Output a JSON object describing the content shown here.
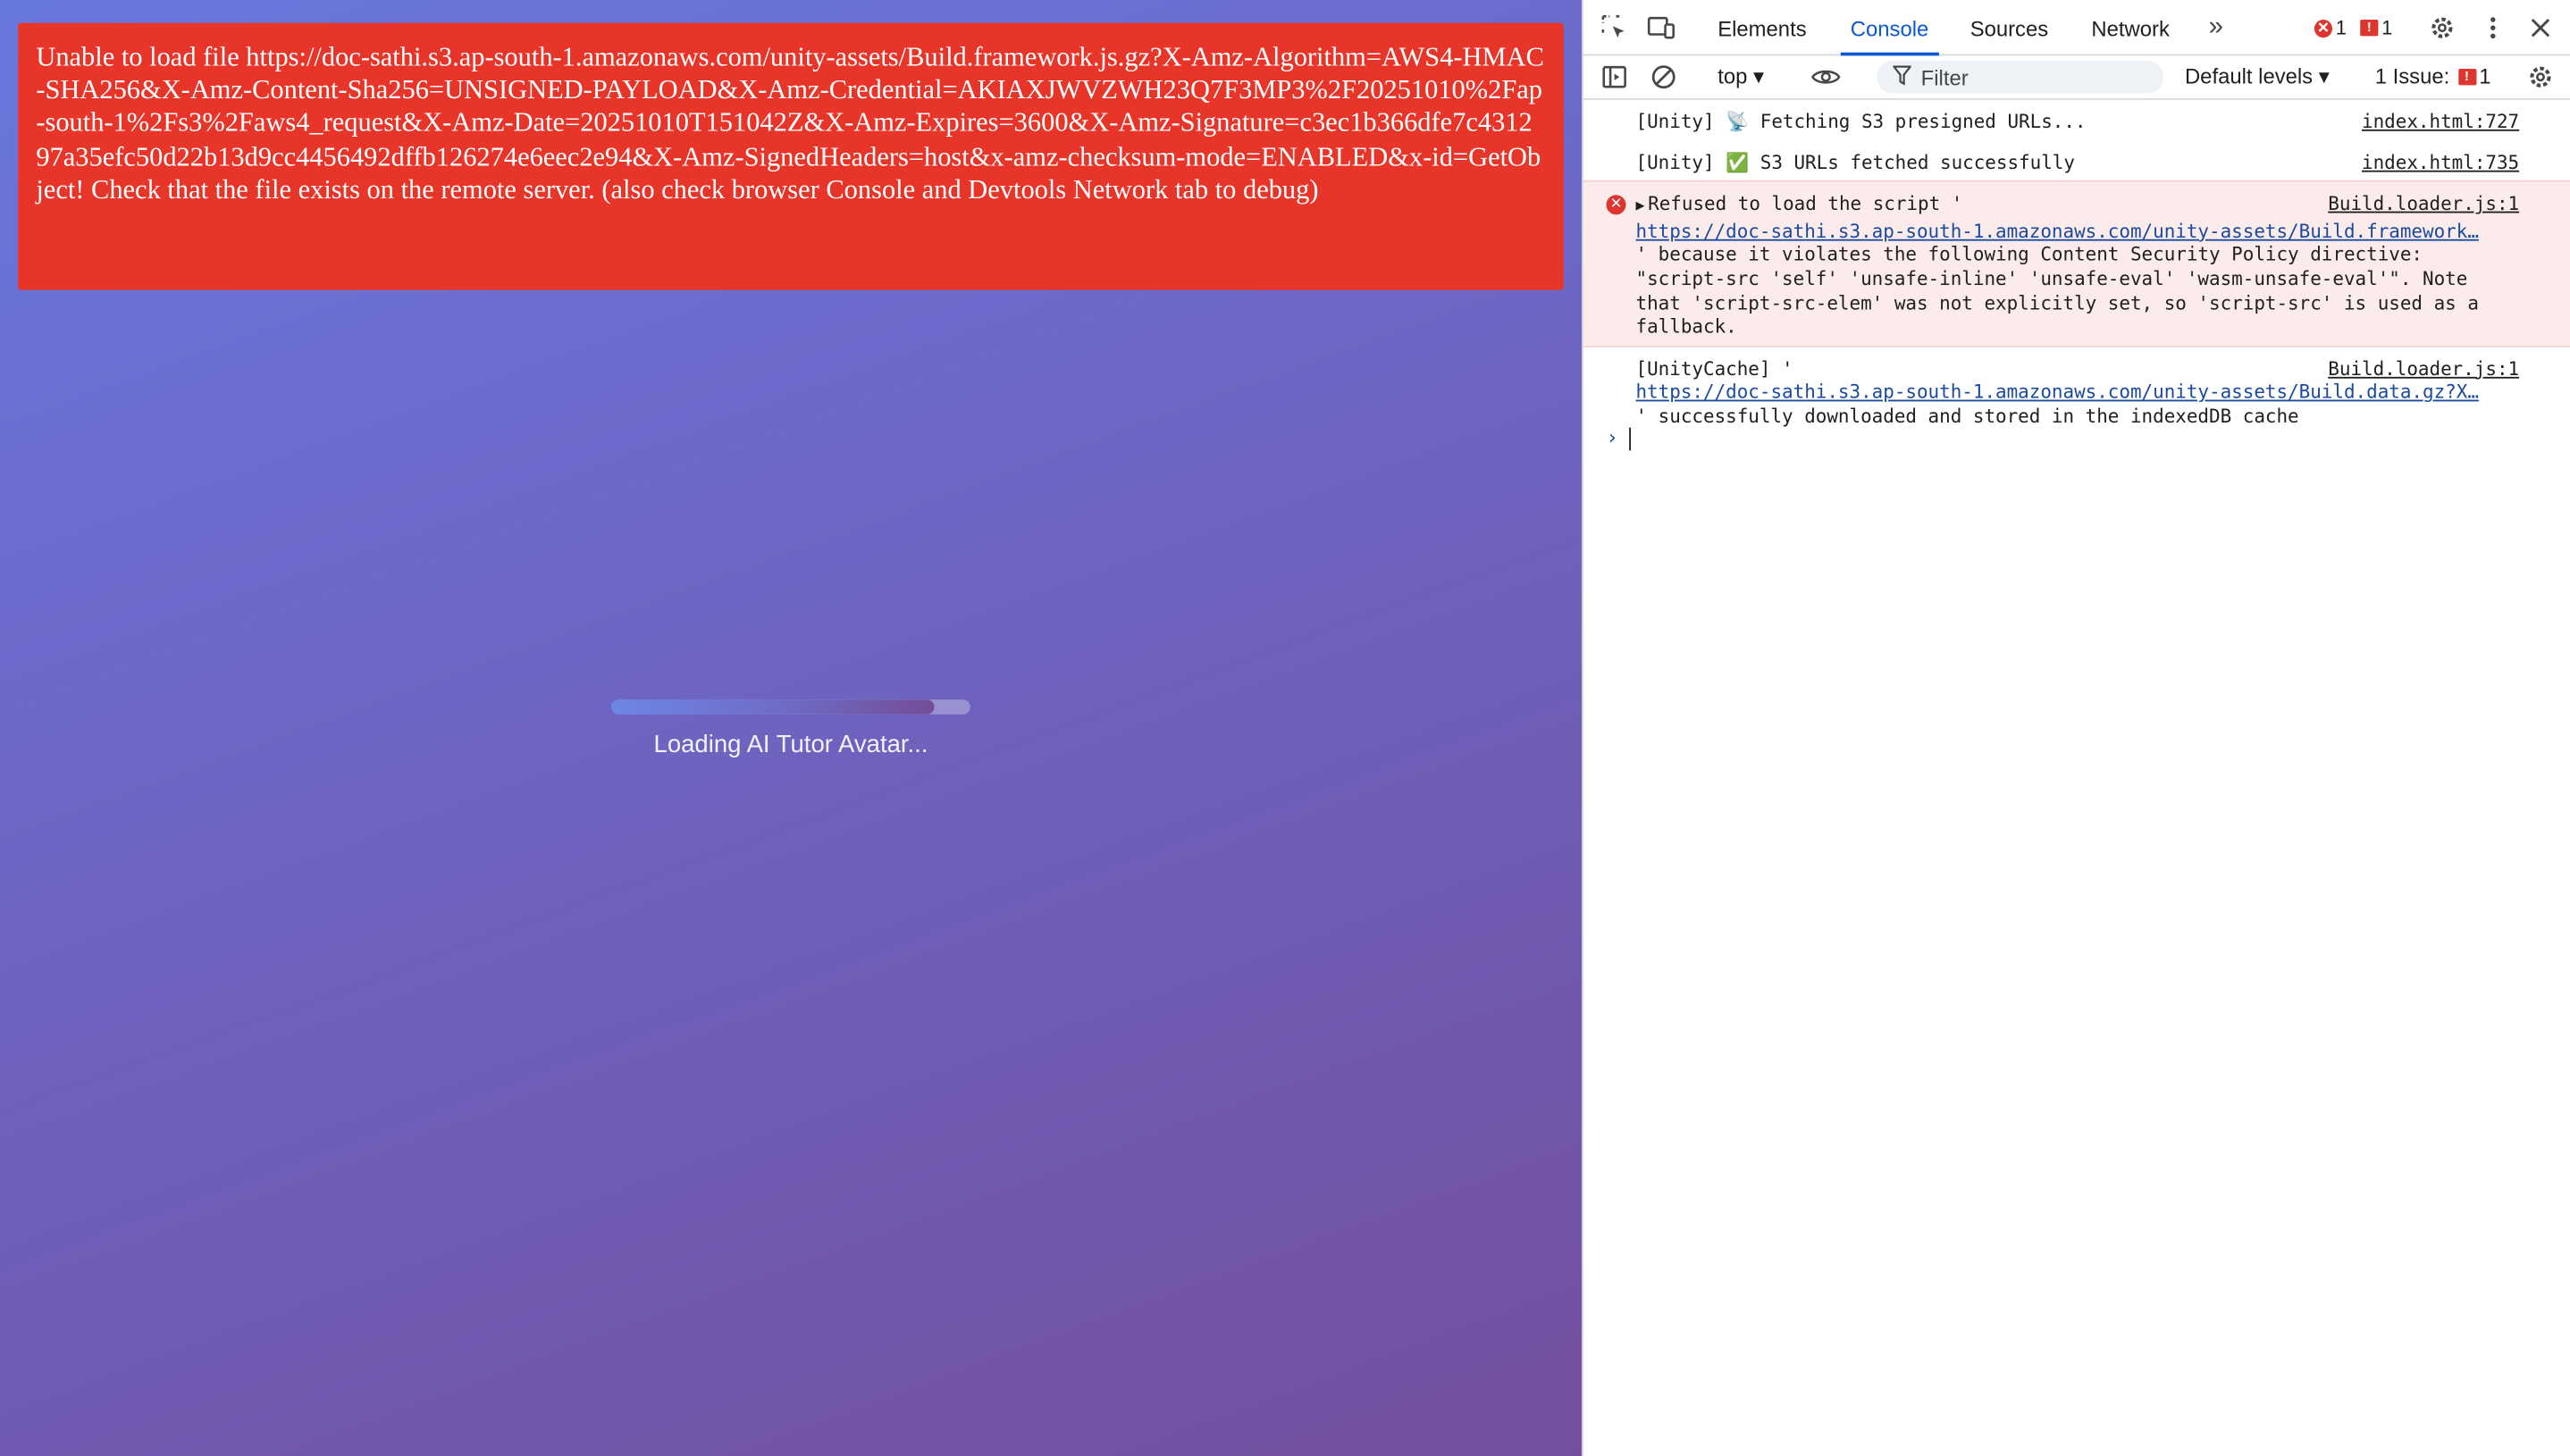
{
  "page": {
    "error_banner": "Unable to load file https://doc-sathi.s3.ap-south-1.amazonaws.com/unity-assets/Build.framework.js.gz?X-Amz-Algorithm=AWS4-HMAC-SHA256&X-Amz-Content-Sha256=UNSIGNED-PAYLOAD&X-Amz-Credential=AKIAXJWVZWH23Q7F3MP3%2F20251010%2Fap-south-1%2Fs3%2Faws4_request&X-Amz-Date=20251010T151042Z&X-Amz-Expires=3600&X-Amz-Signature=c3ec1b366dfe7c431297a35efc50d22b13d9cc4456492dffb126274e6eec2e94&X-Amz-SignedHeaders=host&x-amz-checksum-mode=ENABLED&x-id=GetObject! Check that the file exists on the remote server. (also check browser Console and Devtools Network tab to debug)",
    "loading_text": "Loading AI Tutor Avatar...",
    "progress_fraction": 0.9,
    "colors": {
      "banner": "#e8352a",
      "gradient_start": "#6978de",
      "gradient_end": "#734f9f"
    }
  },
  "devtools": {
    "tabs": [
      "Elements",
      "Console",
      "Sources",
      "Network"
    ],
    "active_tab": "Console",
    "more_tabs_icon": "chevron-double-right-icon",
    "error_count": "1",
    "issue_count": "1",
    "toolbar": {
      "context": "top",
      "filter_placeholder": "Filter",
      "levels": "Default levels",
      "issues_label": "1 Issue:",
      "issues_count": "1"
    },
    "messages": [
      {
        "type": "log",
        "text": "[Unity] 📡 Fetching S3 presigned URLs...",
        "source": "index.html:727"
      },
      {
        "type": "log",
        "text": "[Unity] ✅ S3 URLs fetched successfully",
        "source": "index.html:735"
      },
      {
        "type": "error",
        "text_prefix": "Refused to load the script '",
        "link": "https://doc-sathi.s3.ap-south-1.amazonaws.com/unity-assets/Build.framework…",
        "text_suffix": "' because it violates the following Content Security Policy directive: \"script-src 'self' 'unsafe-inline' 'unsafe-eval' 'wasm-unsafe-eval'\". Note that 'script-src-elem' was not explicitly set, so 'script-src' is used as a fallback.",
        "source": "Build.loader.js:1"
      },
      {
        "type": "log",
        "text_prefix": "[UnityCache] '",
        "link": "https://doc-sathi.s3.ap-south-1.amazonaws.com/unity-assets/Build.data.gz?X…",
        "text_suffix": "' successfully downloaded and stored in the indexedDB cache",
        "source": "Build.loader.js:1"
      }
    ],
    "prompt_symbol": "›"
  }
}
